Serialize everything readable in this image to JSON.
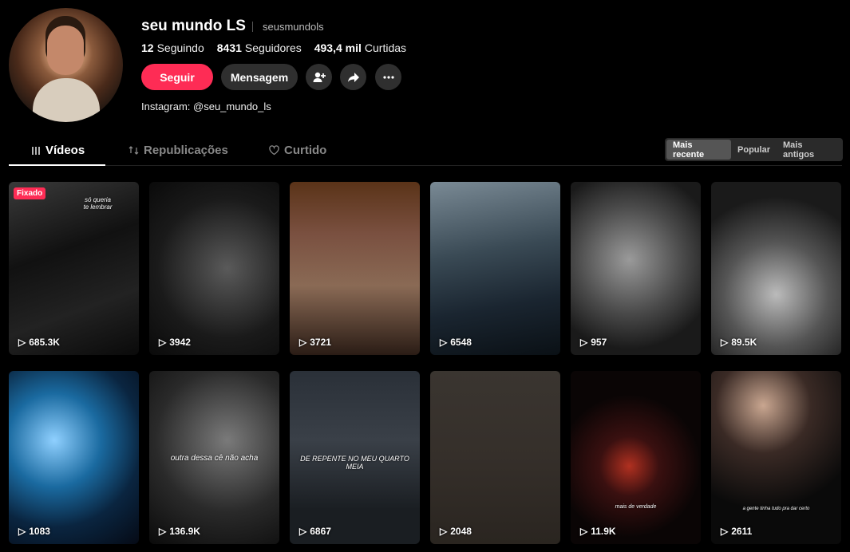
{
  "profile": {
    "display_name": "seu mundo LS",
    "username": "seusmundols",
    "following_count": "12",
    "following_label": "Seguindo",
    "followers_count": "8431",
    "followers_label": "Seguidores",
    "likes_count": "493,4 mil",
    "likes_label": "Curtidas",
    "follow_label": "Seguir",
    "message_label": "Mensagem",
    "bio": "Instagram: @seu_mundo_ls"
  },
  "tabs": [
    {
      "label": "Vídeos",
      "icon": "grid-lines-icon"
    },
    {
      "label": "Republicações",
      "icon": "repost-icon"
    },
    {
      "label": "Curtido",
      "icon": "heart-outline-icon"
    }
  ],
  "sort": {
    "options": [
      "Mais recente",
      "Popular",
      "Mais antigos"
    ],
    "selected": "Mais recente"
  },
  "colors": {
    "accent": "#fe2c55",
    "background": "#000000"
  },
  "videos": [
    {
      "views": "685.3K",
      "pinned_label": "Fixado",
      "caption": "só queria\nte lembrar"
    },
    {
      "views": "3942"
    },
    {
      "views": "3721"
    },
    {
      "views": "6548"
    },
    {
      "views": "957"
    },
    {
      "views": "89.5K"
    },
    {
      "views": "1083"
    },
    {
      "views": "136.9K",
      "caption": "outra dessa cê não acha"
    },
    {
      "views": "6867",
      "caption": "DE REPENTE NO MEU QUARTO\nMEIA"
    },
    {
      "views": "2048"
    },
    {
      "views": "11.9K",
      "caption": "mais de verdade"
    },
    {
      "views": "2611",
      "caption": "a gente tinha tudo pra dar certo"
    }
  ]
}
